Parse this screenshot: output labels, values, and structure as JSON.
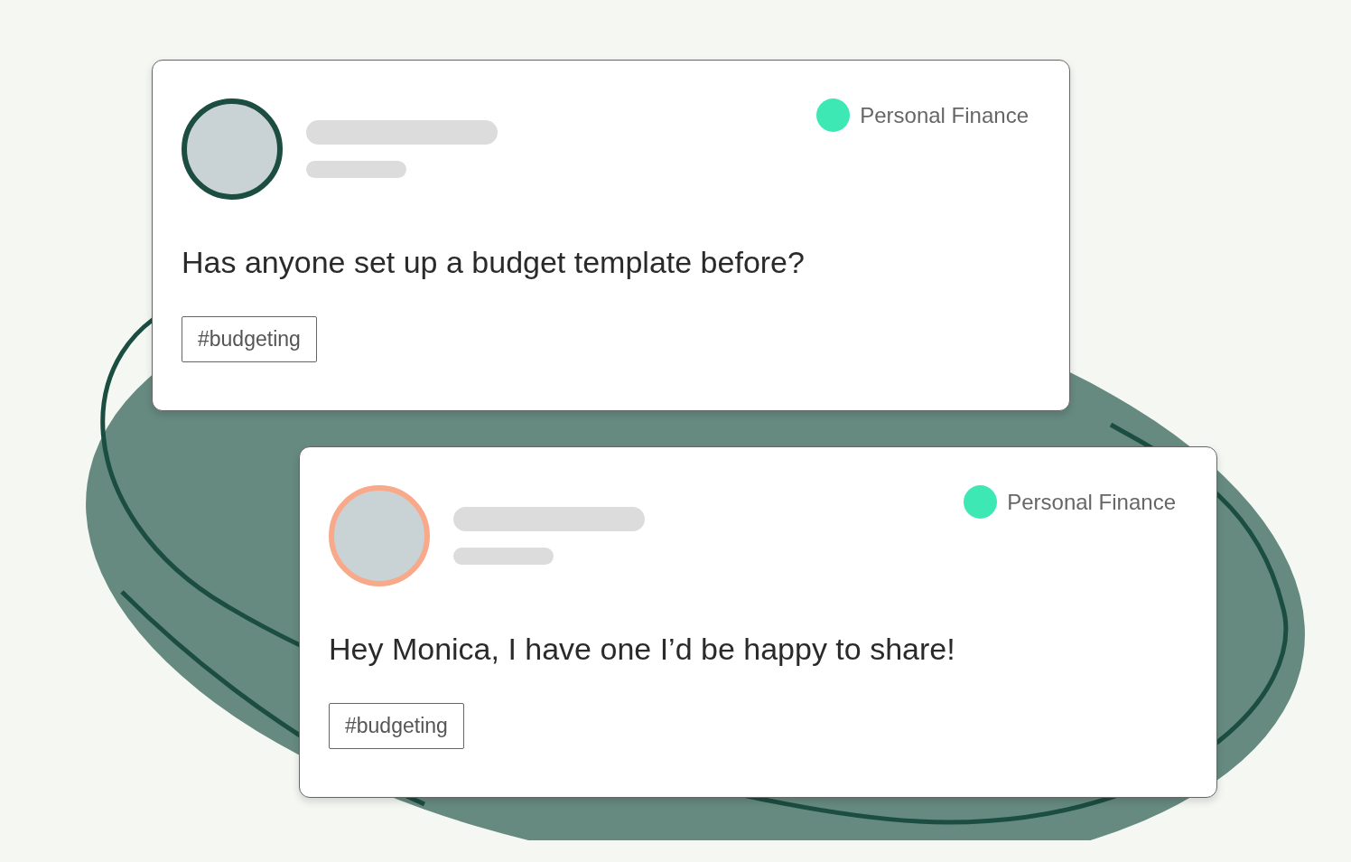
{
  "posts": [
    {
      "avatar": {
        "color": "#1b4d40"
      },
      "category": "Personal Finance",
      "message": "Has anyone set up a budget template before?",
      "tag": "#budgeting"
    },
    {
      "avatar": {
        "color": "#f8a98a"
      },
      "category": "Personal Finance",
      "message": "Hey Monica, I have one I’d be happy to share!",
      "tag": "#budgeting"
    }
  ]
}
